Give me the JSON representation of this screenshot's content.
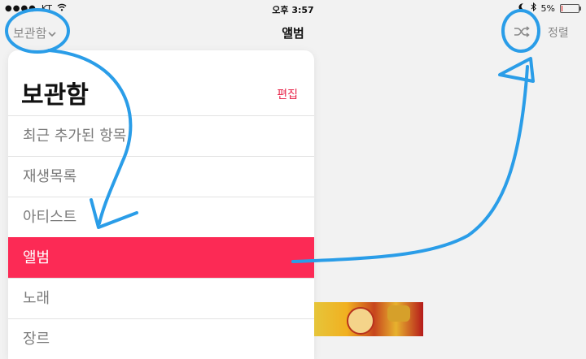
{
  "status": {
    "carrier": "KT",
    "time": "오후 3:57",
    "battery": "5%",
    "battery_level": 0.05,
    "battery_color": "#dd1111"
  },
  "nav": {
    "back_label": "보관함",
    "back_icon": "chevron-down-icon",
    "title": "앨범",
    "shuffle_icon": "shuffle-icon",
    "sort_label": "정렬"
  },
  "library": {
    "title": "보관함",
    "edit_label": "편집",
    "items": [
      {
        "label": "최근 추가된 항목",
        "selected": false
      },
      {
        "label": "재생목록",
        "selected": false
      },
      {
        "label": "아티스트",
        "selected": false
      },
      {
        "label": "앨범",
        "selected": true
      },
      {
        "label": "노래",
        "selected": false
      },
      {
        "label": "장르",
        "selected": false
      }
    ]
  },
  "colors": {
    "accent": "#fc2a55",
    "annotation": "#2a9de8"
  }
}
